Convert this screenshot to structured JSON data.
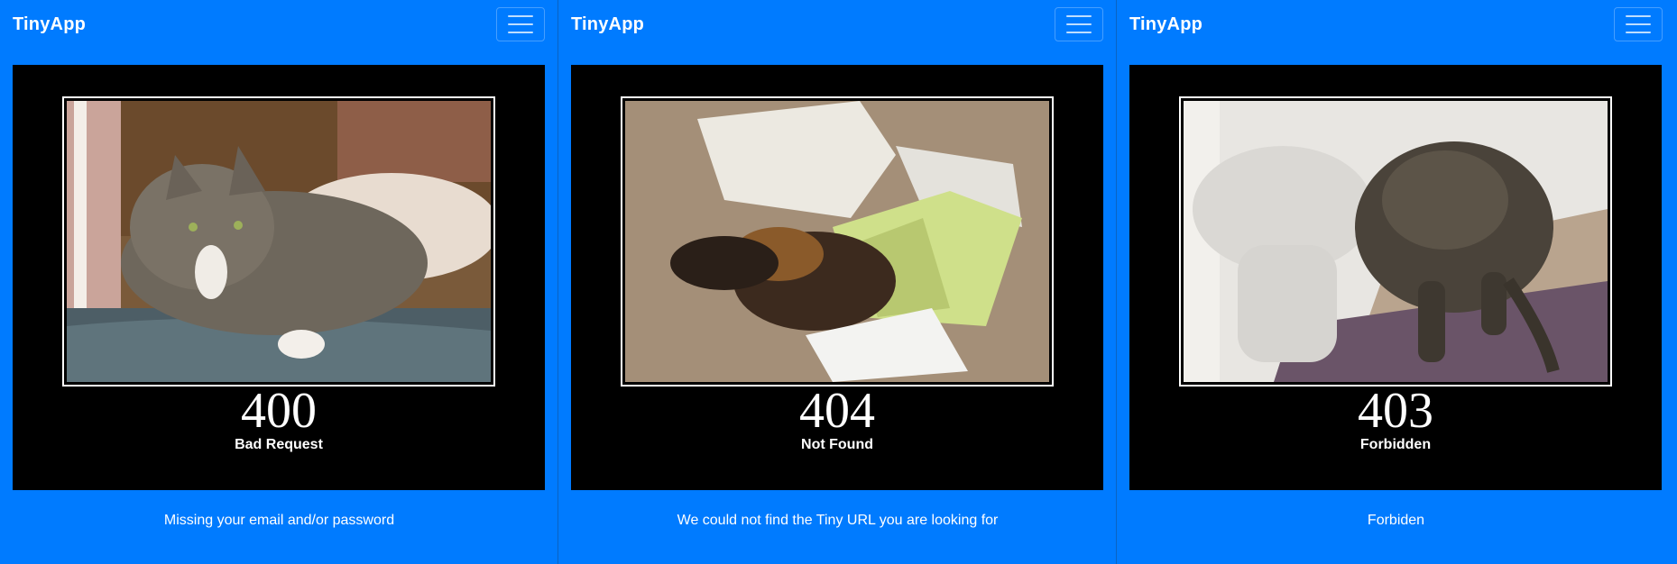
{
  "panels": [
    {
      "brand": "TinyApp",
      "poster": {
        "code": "400",
        "caption": "Bad Request"
      },
      "message": "Missing your email and/or password"
    },
    {
      "brand": "TinyApp",
      "poster": {
        "code": "404",
        "caption": "Not Found"
      },
      "message": "We could not find the Tiny URL you are looking for"
    },
    {
      "brand": "TinyApp",
      "poster": {
        "code": "403",
        "caption": "Forbidden"
      },
      "message": "Forbiden"
    }
  ],
  "icons": {
    "menu": "hamburger-menu-icon"
  },
  "colors": {
    "navbar": "#007bff",
    "poster_bg": "#000000",
    "text": "#ffffff"
  }
}
